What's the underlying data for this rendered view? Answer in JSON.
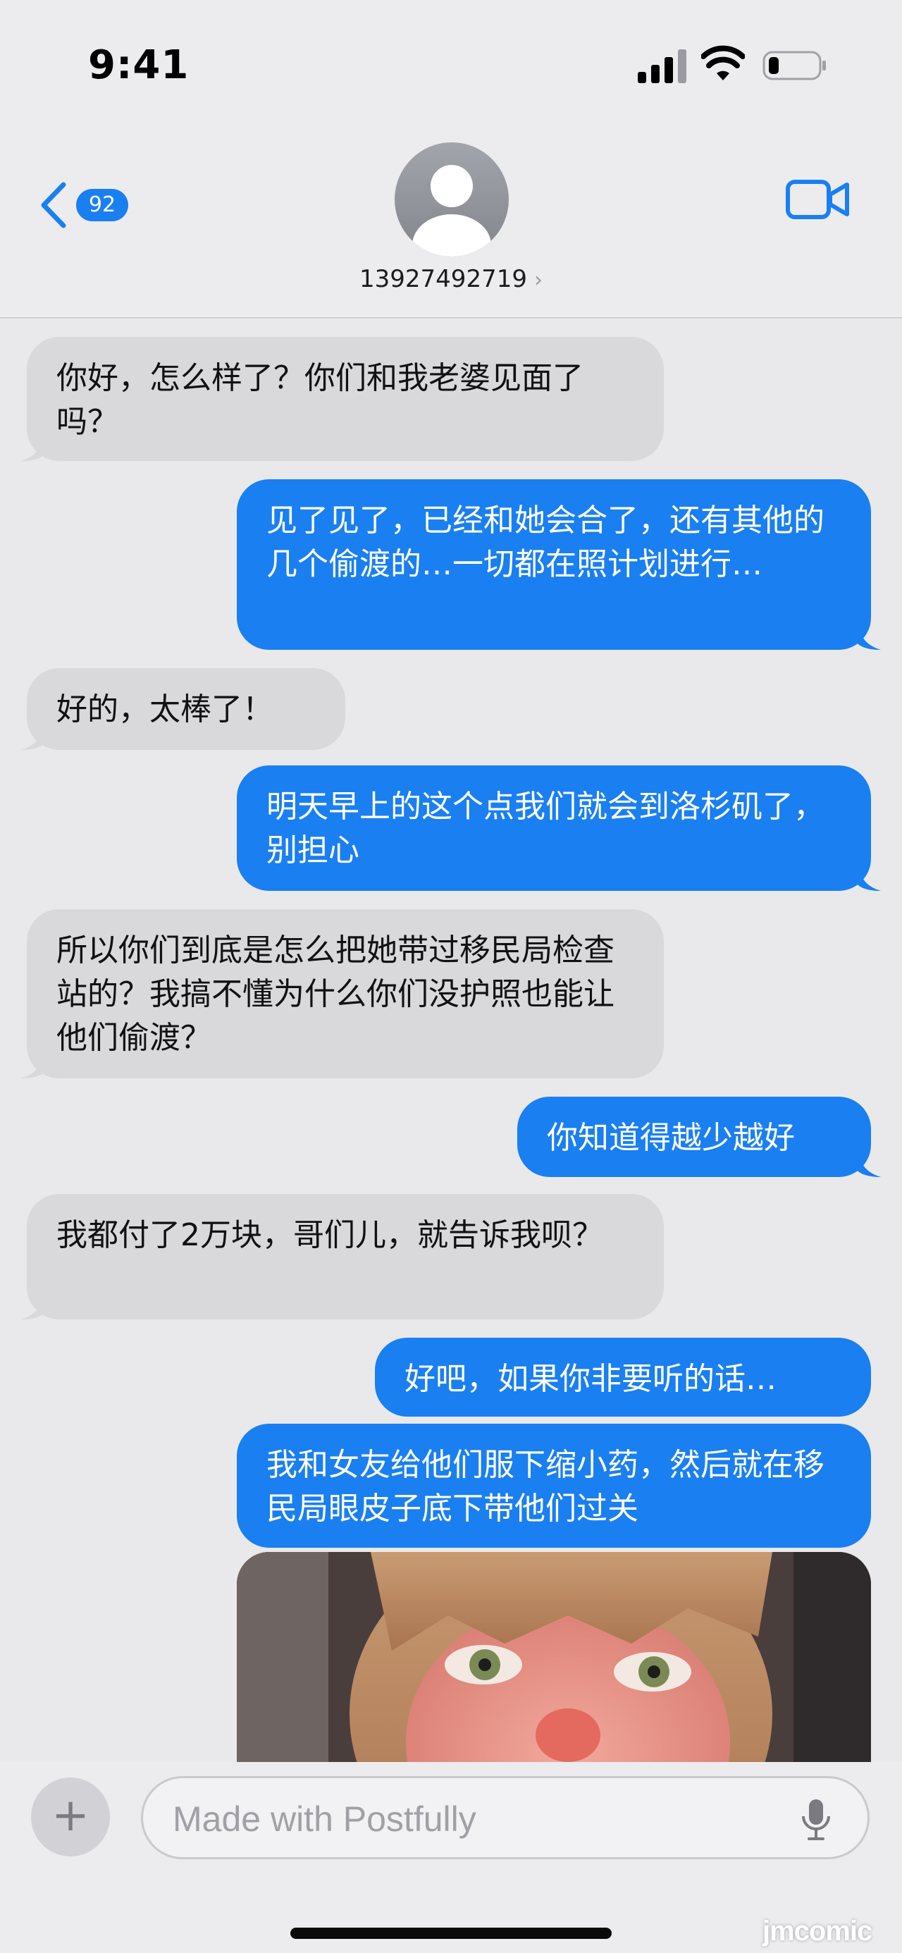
{
  "status_bar": {
    "time": "9:41"
  },
  "header": {
    "back_badge": "92",
    "contact_number": "13927492719",
    "contact_chevron": "›",
    "icons": [
      "chevron-left-icon",
      "person-icon",
      "video-camera-icon"
    ]
  },
  "messages": [
    {
      "direction": "incoming",
      "text": "你好，怎么样了？你们和我老婆见面了吗？"
    },
    {
      "direction": "outgoing",
      "text": "见了见了，已经和她会合了，还有其他的几个偷渡的…一切都在照计划进行…"
    },
    {
      "direction": "incoming",
      "text": "好的，太棒了！"
    },
    {
      "direction": "outgoing",
      "text": "明天早上的这个点我们就会到洛杉矶了，别担心"
    },
    {
      "direction": "incoming",
      "text": "所以你们到底是怎么把她带过移民局检查站的？我搞不懂为什么你们没护照也能让他们偷渡？"
    },
    {
      "direction": "outgoing",
      "text": "你知道得越少越好"
    },
    {
      "direction": "incoming",
      "text": "我都付了2万块，哥们儿，就告诉我呗？"
    },
    {
      "direction": "outgoing",
      "text": "好吧，如果你非要听的话…"
    },
    {
      "direction": "outgoing",
      "text": "我和女友给他们服下缩小药，然后就在移民局眼皮子底下带他们过关"
    }
  ],
  "input_bar": {
    "plus_label": "+",
    "placeholder": "Made with Postfully"
  },
  "watermark": "jmcomic",
  "colors": {
    "accent_blue": "#1a7ff0",
    "incoming_bubble": "#d9d9dc",
    "background": "#e9e9eb"
  }
}
